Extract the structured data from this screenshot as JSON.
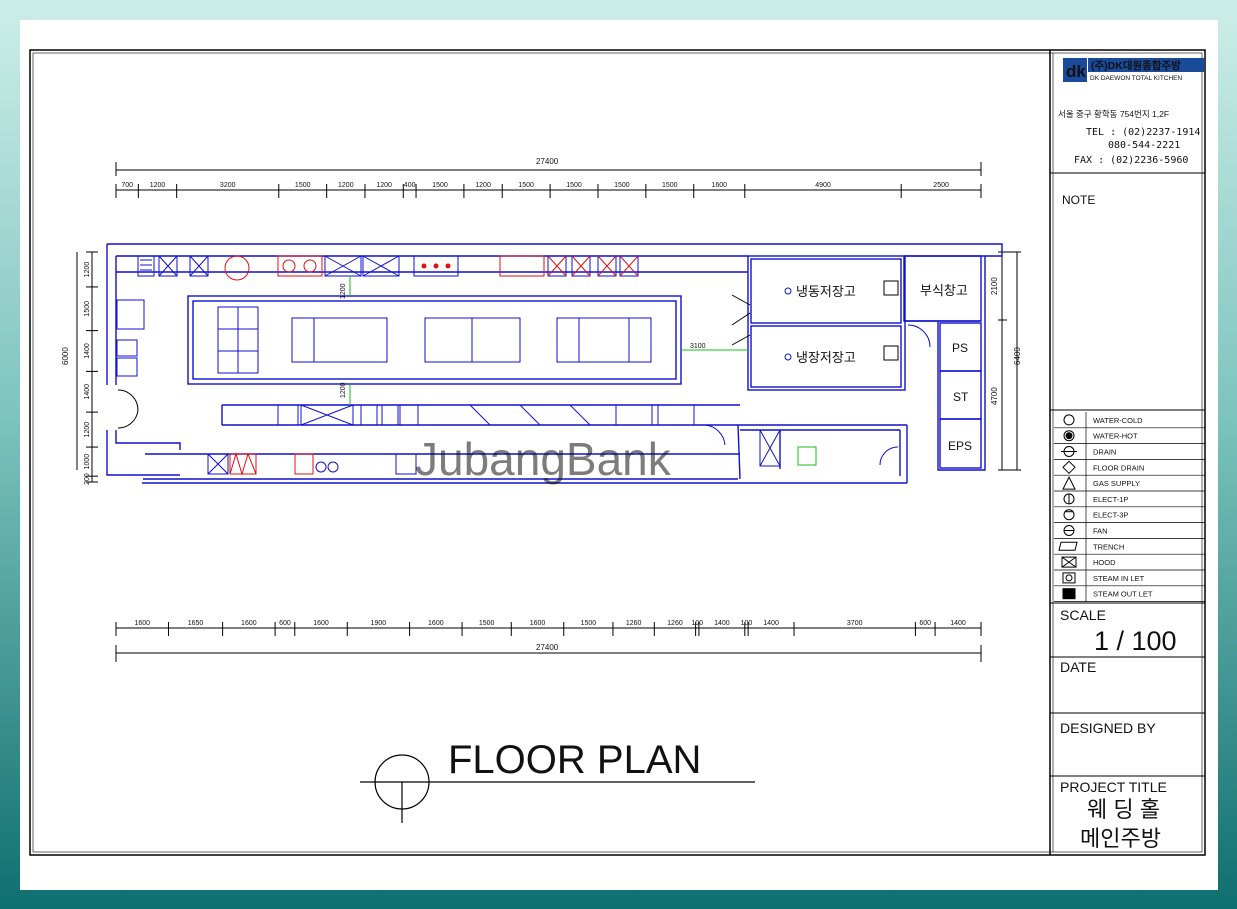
{
  "company": {
    "name": "(주)DK대원종합주방",
    "name_en": "DK DAEWON TOTAL KITCHEN",
    "logo_text": "dk",
    "address": "서울 중구 황학동 754번지 1,2F",
    "tel": "TEL : (02)2237-1914",
    "tel2": "080-544-2221",
    "fax": "FAX : (02)2236-5960"
  },
  "titleblock": {
    "note_label": "NOTE",
    "scale_label": "SCALE",
    "scale_value": "1 / 100",
    "date_label": "DATE",
    "designed_label": "DESIGNED BY",
    "project_label": "PROJECT TITLE",
    "project_line1": "웨 딩 홀",
    "project_line2": "메인주방"
  },
  "legend": [
    {
      "icon": "water-cold-icon",
      "label": "WATER-COLD"
    },
    {
      "icon": "water-hot-icon",
      "label": "WATER-HOT"
    },
    {
      "icon": "drain-icon",
      "label": "DRAIN"
    },
    {
      "icon": "floor-drain-icon",
      "label": "FLOOR DRAIN"
    },
    {
      "icon": "gas-supply-icon",
      "label": "GAS SUPPLY"
    },
    {
      "icon": "elect-1p-icon",
      "label": "ELECT-1P"
    },
    {
      "icon": "elect-3p-icon",
      "label": "ELECT-3P"
    },
    {
      "icon": "fan-icon",
      "label": "FAN"
    },
    {
      "icon": "trench-icon",
      "label": "TRENCH"
    },
    {
      "icon": "hood-icon",
      "label": "HOOD"
    },
    {
      "icon": "steam-inlet-icon",
      "label": "STEAM IN LET"
    },
    {
      "icon": "steam-outlet-icon",
      "label": "STEAM OUT LET"
    }
  ],
  "plan": {
    "title": "FLOOR PLAN",
    "total_top": "27400",
    "total_bottom": "27400",
    "top_dims": [
      "700",
      "1200",
      "3200",
      "1500",
      "1200",
      "1200",
      "400",
      "1500",
      "1200",
      "1500",
      "1500",
      "1500",
      "1500",
      "1600",
      "4900",
      "2500"
    ],
    "bottom_dims": [
      "1600",
      "1650",
      "1600",
      "600",
      "1600",
      "1900",
      "1600",
      "1500",
      "1600",
      "1500",
      "1260",
      "1260",
      "100",
      "1400",
      "100",
      "1400",
      "3700",
      "600",
      "1400"
    ],
    "left_dims": [
      "1200",
      "1500",
      "1400",
      "1400",
      "1200",
      "1000",
      "200"
    ],
    "left_total": "6000",
    "right_dims": [
      "2100",
      "4700"
    ],
    "right_total": "6400",
    "inner_dim_1": "1200",
    "inner_dim_2": "1200",
    "inner_dim_3": "3100",
    "rooms": {
      "freezer": "냉동저장고",
      "cooler": "냉장저장고",
      "sub_storage": "부식창고",
      "ps": "PS",
      "st": "ST",
      "eps": "EPS"
    },
    "watermark": "JubangBank"
  },
  "colors": {
    "line": "#000000",
    "plan_blue": "#1010d0",
    "equip_red": "#e01010",
    "dim_green": "#10c010",
    "logo_blue": "#1a4a9a"
  }
}
